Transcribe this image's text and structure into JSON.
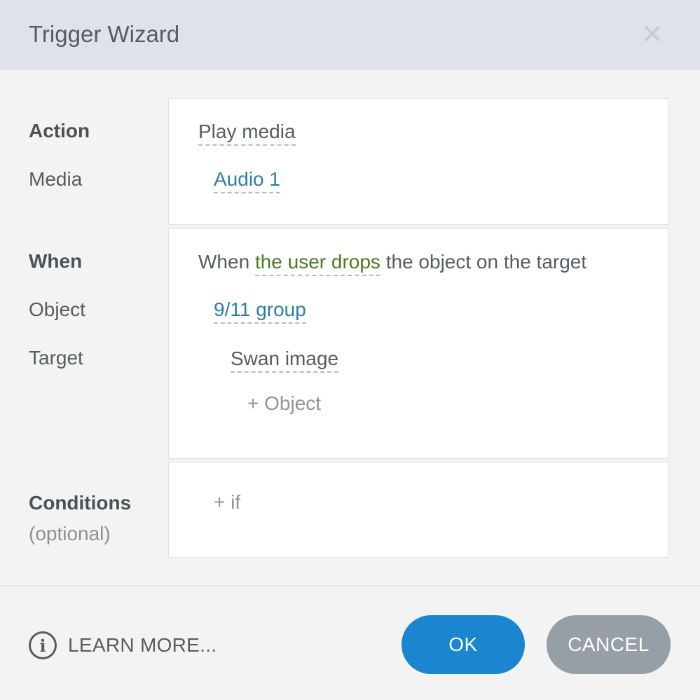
{
  "dialog": {
    "title": "Trigger Wizard"
  },
  "action": {
    "label": "Action",
    "value": "Play media",
    "media_label": "Media",
    "media_value": "Audio 1"
  },
  "when": {
    "label": "When",
    "text_prefix": "When",
    "event": "the user drops",
    "text_suffix": "the object on the target",
    "object_label": "Object",
    "object_value": "9/11 group",
    "target_label": "Target",
    "target_value": "Swan image",
    "add_object": "+ Object"
  },
  "conditions": {
    "label": "Conditions",
    "sublabel": "(optional)",
    "add_if": "+ if"
  },
  "footer": {
    "learn_more": "LEARN MORE...",
    "info_glyph": "i",
    "ok": "OK",
    "cancel": "CANCEL"
  },
  "colors": {
    "ok_button": "#1a86d0",
    "cancel_button": "#979fa6",
    "link_blue": "#2b7fa3",
    "event_green": "#4c7a1f"
  },
  "icons": [
    "close-icon",
    "info-icon"
  ]
}
